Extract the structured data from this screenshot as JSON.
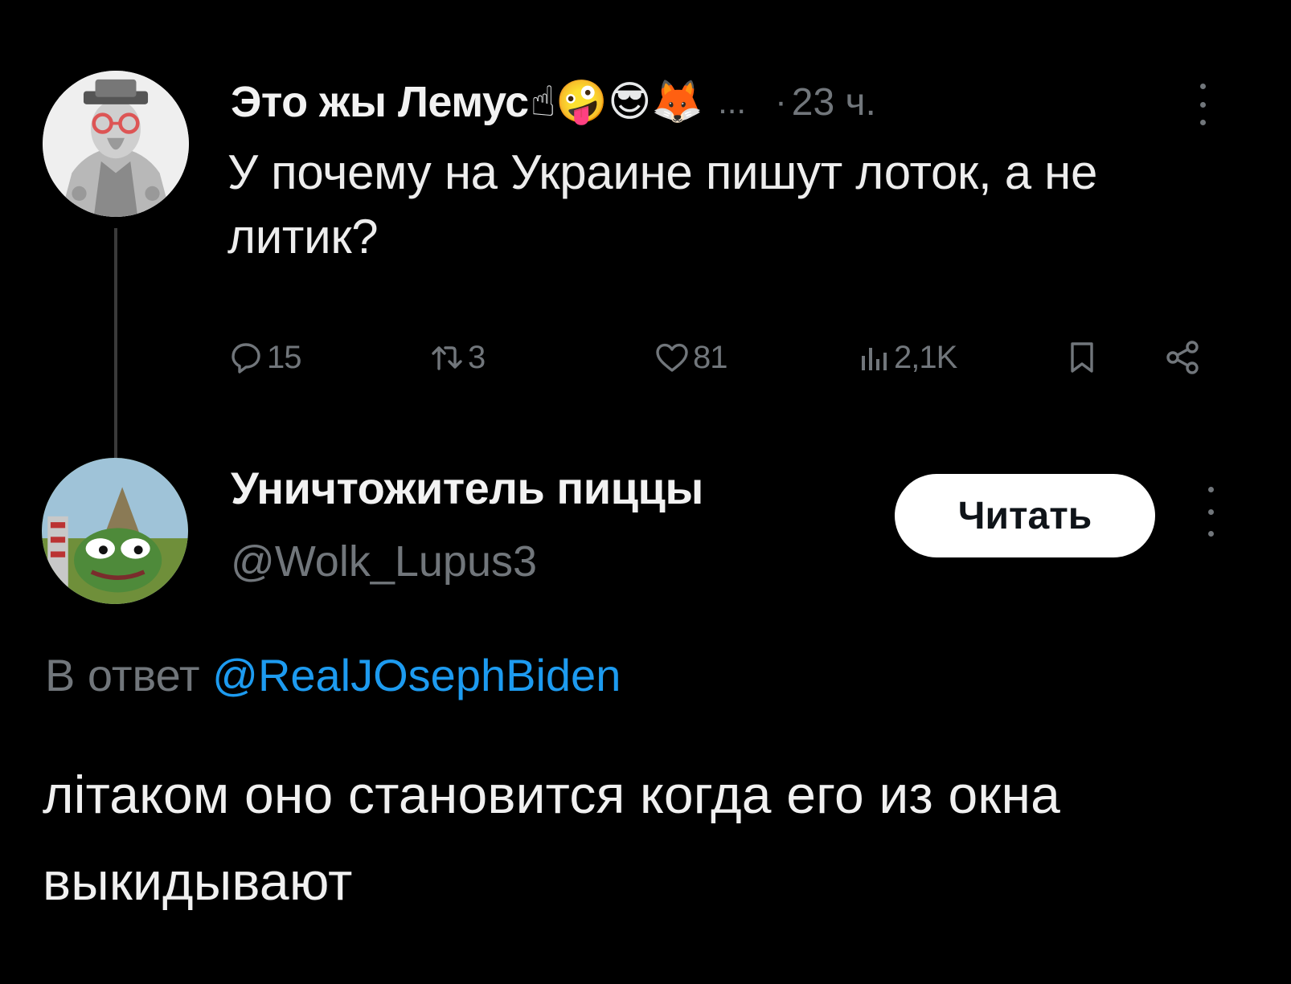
{
  "parent_tweet": {
    "display_name": "Это жы Лемус",
    "name_emojis": "☝🤪😎🦊",
    "name_truncation": "...",
    "separator": "·",
    "time": "23 ч.",
    "text": "У почему на Украине пишут лоток, а не литик?",
    "actions": {
      "replies": "15",
      "reposts": "3",
      "likes": "81",
      "views": "2,1K"
    },
    "icons": {
      "reply": "reply-icon",
      "repost": "repost-icon",
      "like": "heart-icon",
      "views": "views-icon",
      "bookmark": "bookmark-icon",
      "share": "share-icon",
      "more": "more-icon"
    }
  },
  "reply_tweet": {
    "display_name": "Уничтожитель пиццы",
    "handle": "@Wolk_Lupus3",
    "follow_label": "Читать",
    "reply_to_label": "В ответ",
    "reply_to_handle": "@RealJOsephBiden",
    "text": "лiтаком оно становится когда его из окна выкидывают"
  },
  "colors": {
    "background": "#000000",
    "text": "#e7e9ea",
    "muted": "#71767b",
    "link": "#1d9bf0",
    "button_bg": "#ffffff"
  }
}
